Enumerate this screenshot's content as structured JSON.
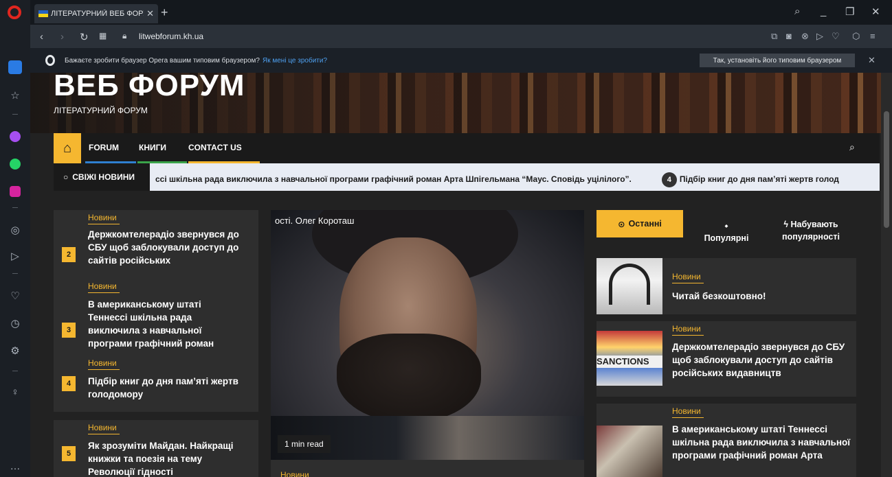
{
  "browser": {
    "tab_title": "ЛІТЕРАТУРНИЙ ВЕБ ФОРУ",
    "url": "litwebforum.kh.ua",
    "default_prompt": "Бажаєте зробити браузер Opera вашим типовим браузером?",
    "default_link": "Як мені це зробити?",
    "default_button": "Так, установіть його типовим браузером"
  },
  "site": {
    "title": "ВЕБ ФОРУМ",
    "subtitle": "ЛІТЕРАТУРНИЙ ФОРУМ"
  },
  "menu": {
    "items": [
      {
        "label": "FORUM",
        "color": "#2f80d1"
      },
      {
        "label": "КНИГИ",
        "color": "#3aa34a"
      },
      {
        "label": "CONTACT US",
        "color": "#f5b730"
      }
    ]
  },
  "ticker": {
    "label": "СВІЖІ НОВИНИ",
    "text1": "ссі шкільна рада виключила з навчальної програми графічний роман Арта Шпігельмана “Маус. Сповідь уцілілого”.",
    "badge": "4",
    "text2": "Підбір книг до дня пам’яті жертв голод"
  },
  "left_news": [
    {
      "num": "2",
      "category": "Новини",
      "title": "Держкомтелерадіо звернувся до СБУ щоб заблокували доступ до сайтів російських"
    },
    {
      "num": "3",
      "category": "Новини",
      "title": "В американському штаті Теннессі шкільна рада виключила з навчальної програми графічний роман"
    },
    {
      "num": "4",
      "category": "Новини",
      "title": "Підбір книг до дня пам’яті жертв голодомору"
    },
    {
      "num": "5",
      "category": "Новини",
      "title": "Як зрозуміти Майдан. Найкращі книжки та поезія на тему Революції гідності"
    }
  ],
  "feature": {
    "caption": "ості. Олег Короташ",
    "read_time": "1 min read",
    "category": "Новини"
  },
  "right": {
    "tabs": {
      "latest": "Останні",
      "popular": "Популярні",
      "trending": "Набувають популярності"
    },
    "items": [
      {
        "category": "Новини",
        "title": "Читай безкоштовно!"
      },
      {
        "category": "Новини",
        "title": "Держкомтелерадіо звернувся до СБУ щоб заблокували доступ до сайтів російських видавництв"
      },
      {
        "category": "Новини",
        "title": "В американському штаті Теннессі шкільна рада виключила з навчальної програми графічний роман Арта"
      }
    ],
    "sanctions_word": "SANCTIONS"
  },
  "colors": {
    "accent": "#f5b730",
    "dark": "#1a1a1a",
    "card": "#2e2e2e"
  }
}
